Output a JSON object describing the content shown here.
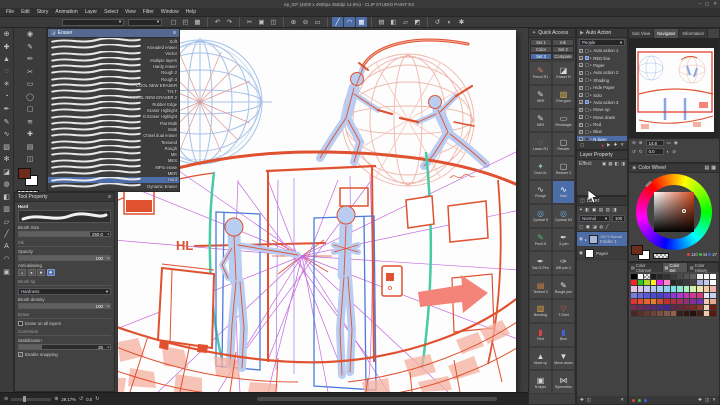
{
  "window": {
    "title": "ep_03* (4000 x 4500px 350dpi 14.8%) - CLIP STUDIO PAINT EX",
    "minimize": "–",
    "maximize": "▢",
    "close": "✕"
  },
  "menu": [
    "File",
    "Edit",
    "Story",
    "Animation",
    "Layer",
    "Select",
    "View",
    "Filter",
    "Window",
    "Help"
  ],
  "command_bar": {
    "icons": [
      {
        "name": "new-file",
        "glyph": "▢"
      },
      {
        "name": "open-file",
        "glyph": "◰"
      },
      {
        "name": "save-file",
        "glyph": "▦"
      },
      {
        "name": "sep"
      },
      {
        "name": "undo",
        "glyph": "↶"
      },
      {
        "name": "redo",
        "glyph": "↷"
      },
      {
        "name": "sep"
      },
      {
        "name": "cut",
        "glyph": "✂"
      },
      {
        "name": "copy",
        "glyph": "▣"
      },
      {
        "name": "paste",
        "glyph": "◫"
      },
      {
        "name": "sep"
      },
      {
        "name": "zoom-in",
        "glyph": "⊕"
      },
      {
        "name": "zoom-out",
        "glyph": "⊖"
      },
      {
        "name": "fit-screen",
        "glyph": "▭"
      },
      {
        "name": "sep"
      },
      {
        "name": "snap-ruler",
        "glyph": "╱",
        "active": true
      },
      {
        "name": "snap-special-ruler",
        "glyph": "◠",
        "active": true
      },
      {
        "name": "snap-grid",
        "glyph": "▦",
        "active": true
      },
      {
        "name": "sep"
      },
      {
        "name": "grid",
        "glyph": "▤"
      },
      {
        "name": "material",
        "glyph": "◧"
      },
      {
        "name": "select-area",
        "glyph": "▱"
      },
      {
        "name": "deselect",
        "glyph": "◩"
      },
      {
        "name": "sep"
      },
      {
        "name": "rotate-view",
        "glyph": "↺"
      },
      {
        "name": "flip-view",
        "glyph": "◐"
      },
      {
        "name": "settings",
        "glyph": "✱"
      }
    ]
  },
  "tool_strip_a": [
    {
      "name": "zoom-tool",
      "glyph": "⊕"
    },
    {
      "name": "move-tool",
      "glyph": "✚"
    },
    {
      "name": "operation-tool",
      "glyph": "▲"
    },
    {
      "name": "selection-tool",
      "glyph": "◌"
    },
    {
      "name": "wand-tool",
      "glyph": "✳"
    },
    {
      "name": "eyedropper-tool",
      "glyph": "◔"
    },
    {
      "name": "pen-tool",
      "glyph": "✒"
    },
    {
      "name": "pencil-tool",
      "glyph": "✎"
    },
    {
      "name": "brush-tool",
      "glyph": "∿"
    },
    {
      "name": "airbrush-tool",
      "glyph": "▨"
    },
    {
      "name": "decoration-tool",
      "glyph": "✻"
    },
    {
      "name": "eraser-tool",
      "glyph": "◪"
    },
    {
      "name": "blend-tool",
      "glyph": "◍"
    },
    {
      "name": "fill-tool",
      "glyph": "◧"
    },
    {
      "name": "gradient-tool",
      "glyph": "▥"
    },
    {
      "name": "figure-tool",
      "glyph": "▱"
    },
    {
      "name": "ruler-tool",
      "glyph": "╱"
    },
    {
      "name": "text-tool",
      "glyph": "A"
    },
    {
      "name": "balloon-tool",
      "glyph": "◠"
    },
    {
      "name": "frame-border-tool",
      "glyph": "▣"
    }
  ],
  "tool_strip_b": [
    {
      "name": "subtool-marker",
      "glyph": "◉"
    },
    {
      "name": "subtool-pen",
      "glyph": "✎"
    },
    {
      "name": "subtool-pencil",
      "glyph": "✏"
    },
    {
      "name": "subtool-scissors",
      "glyph": "✂"
    },
    {
      "name": "subtool-rect",
      "glyph": "▭"
    },
    {
      "name": "subtool-circle",
      "glyph": "◯"
    },
    {
      "name": "subtool-square",
      "glyph": "▢"
    },
    {
      "name": "subtool-wave",
      "glyph": "≋"
    },
    {
      "name": "subtool-plus",
      "glyph": "✚"
    },
    {
      "name": "subtool-rows",
      "glyph": "▤"
    },
    {
      "name": "subtool-panel",
      "glyph": "◫"
    }
  ],
  "tool_strip_b_tail": [
    {
      "name": "subtool-grid2",
      "glyph": "▦"
    },
    {
      "name": "subtool-diamond",
      "glyph": "◈"
    }
  ],
  "colors": {
    "foreground": "#6e2c1b",
    "background": "#ffffff",
    "selection": "#4d6da8",
    "accent_green": "#3aa34a"
  },
  "subtool": {
    "header": "Eraser",
    "selected": "Hard",
    "items": [
      "Soft",
      "Kneaded eraser",
      "Vector",
      "Multiple layers",
      "Hardy eraser",
      "Rough 2",
      "Rough 3",
      "COOL NEW ERASER",
      "T.N.T",
      "COOL NEW ERASER 2",
      "Rubber Edge",
      "Eraser Highlight",
      "G.Eraser Highlight",
      "Flat Multi",
      "Multi",
      "Chisel dual eraser",
      "Textured",
      "Rough",
      "ME",
      "MES",
      "MPro erase",
      "MER",
      "Hard",
      "Dynamic Eraser"
    ]
  },
  "tool_property": {
    "header": "Tool Property",
    "tool": "Hard",
    "brush_size_label": "Brush Size",
    "brush_size": "250.0",
    "ink_section": "Ink",
    "opacity_label": "Opacity",
    "opacity": "100",
    "anti_aliasing_label": "Anti-aliasing",
    "brush_tip_section": "Brush tip",
    "tip_shape": "Hardness",
    "density_label": "Brush density",
    "density": "100",
    "erase_section": "Erase",
    "erase_all_label": "Erase on all layers",
    "correction_section": "Correction",
    "stabilization_label": "Stabilization",
    "stabilization": "25",
    "snapping_label": "Enable snapping"
  },
  "quick_access": {
    "header": "Quick Access",
    "sets": [
      "Set 1",
      "Ink",
      "Color",
      "Set 2",
      "Set 3",
      "Compare"
    ],
    "active_set": "Set 3",
    "selected_tool": "Hard",
    "tools": [
      {
        "label": "Pencil R1",
        "glyph": "✎",
        "color": "#e07a5a"
      },
      {
        "label": "Eraser H",
        "glyph": "◪",
        "color": "#d8d8d8"
      },
      {
        "label": "MER",
        "glyph": "✎",
        "color": "#d8d8d8"
      },
      {
        "label": "Rim gum",
        "glyph": "▨",
        "color": "#d8b84a"
      },
      {
        "label": "MES",
        "glyph": "✎",
        "color": "#d8d8d8"
      },
      {
        "label": "Rectangle",
        "glyph": "▭",
        "color": "#d8d8d8"
      },
      {
        "label": "Lasso R1",
        "glyph": "◌",
        "color": "#7ec8b0"
      },
      {
        "label": "Resizer",
        "glyph": "▢",
        "color": "#d8d8d8"
      },
      {
        "label": "Dust Gr",
        "glyph": "✦",
        "color": "#7ec8b0"
      },
      {
        "label": "Resizer 2",
        "glyph": "▢",
        "color": "#d8d8d8"
      },
      {
        "label": "Rough",
        "glyph": "∿",
        "color": "#d8d8d8"
      },
      {
        "label": "Hard",
        "glyph": "∿",
        "color": "#ffffff"
      },
      {
        "label": "Cymbal H",
        "glyph": "◎",
        "color": "#6fa8dc"
      },
      {
        "label": "Cymbal H2",
        "glyph": "◎",
        "color": "#6fa8dc"
      },
      {
        "label": "Pecil H",
        "glyph": "✎",
        "color": "#5bb87a"
      },
      {
        "label": "G-pen",
        "glyph": "✒",
        "color": "#d8d8d8"
      },
      {
        "label": "Sat G-Pen",
        "glyph": "✒",
        "color": "#d8d8d8"
      },
      {
        "label": "WB pen 2",
        "glyph": "✑",
        "color": "#d8d8d8"
      },
      {
        "label": "Textred 2",
        "glyph": "▤",
        "color": "#d8864a"
      },
      {
        "label": "Rough pen",
        "glyph": "✎",
        "color": "#e0e0e0"
      },
      {
        "label": "Bending",
        "glyph": "▧",
        "color": "#e0a040"
      },
      {
        "label": "T-Shirt",
        "glyph": "▽",
        "color": "#d05050"
      },
      {
        "label": "Red",
        "glyph": "▮",
        "color": "#e04040"
      },
      {
        "label": "Blue",
        "glyph": "▮",
        "color": "#4060e0"
      },
      {
        "label": "Move up",
        "glyph": "▲",
        "color": "#d8d8d8"
      },
      {
        "label": "Move down",
        "glyph": "▼",
        "color": "#d8d8d8"
      },
      {
        "label": "N layer",
        "glyph": "▣",
        "color": "#d8d8d8"
      },
      {
        "label": "Symmetric",
        "glyph": "⋈",
        "color": "#d8d8d8"
      }
    ]
  },
  "auto_action": {
    "header": "Auto Action",
    "group": "People",
    "selected": "N layer",
    "actions": [
      {
        "label": "Auto action 1",
        "chip": false
      },
      {
        "label": "RED line",
        "chip": true
      },
      {
        "label": "Paper",
        "chip": false
      },
      {
        "label": "Auto action 2",
        "chip": false
      },
      {
        "label": "Shading",
        "chip": false
      },
      {
        "label": "Hide Paper",
        "chip": false
      },
      {
        "label": "Solo",
        "chip": false
      },
      {
        "label": "Auto action 3",
        "chip": true
      },
      {
        "label": "Move up",
        "chip": false
      },
      {
        "label": "Move down",
        "chip": false
      },
      {
        "label": "Red",
        "chip": false
      },
      {
        "label": "Blue",
        "chip": false
      },
      {
        "label": "N layer",
        "chip": false
      }
    ]
  },
  "layer_property": {
    "header": "Layer Property",
    "effect_label": "Effect"
  },
  "layer": {
    "header": "Layer",
    "blend_mode": "Normal",
    "opacity": "100",
    "items": [
      {
        "name": "Folder 1",
        "info": "100 % Normal",
        "kind": "folder",
        "selected": true
      },
      {
        "name": "Paper",
        "info": "",
        "kind": "paper",
        "selected": false
      }
    ]
  },
  "navigator": {
    "tabs": [
      "Sub View",
      "Navigator",
      "Information"
    ],
    "active_tab": "Navigator",
    "zoom": "14.8",
    "rotation": "0.0"
  },
  "color_wheel": {
    "header": "Color Wheel",
    "r_value": "110",
    "g_value": "44",
    "b_value": "27"
  },
  "color_set": {
    "tabs": [
      "Color Channel",
      "Color Set",
      "Color History"
    ],
    "active_tab": "Color Set",
    "swatches": [
      [
        "#000000",
        "#ffffff",
        "checker",
        "#1c1c1c",
        "#282828",
        "#333333",
        "#3e3e3e",
        "#4a4a4a",
        "#555555",
        "#606060",
        "#f0f0f0",
        "#f8f8f8",
        "#ffffff"
      ],
      [
        "#ff2020",
        "#22cc22",
        "#aadd22",
        "#ffee22",
        "#ee22ee",
        "#ff88cc",
        "#262626",
        "#303030",
        "#3a3a3a",
        "#444444",
        "#aab0e0",
        "#c6ccf0",
        "#ffffff"
      ],
      [
        "#e6c6e6",
        "#d9c6f0",
        "#c6c6f5",
        "#b3c6f5",
        "#a0ccf5",
        "#8cd2f0",
        "#7edce6",
        "#8ce6d2",
        "#aaf0c6",
        "#d2f0aa",
        "#f0e6aa",
        "#f0cfa8",
        "#f0b4a8"
      ],
      [
        "#7a7ae6",
        "#6a6ae0",
        "#5a5ad9",
        "#4a4ad2",
        "#4444cc",
        "#6a3ad2",
        "#8a3ad2",
        "#aa3ad2",
        "#c23ab8",
        "#cc3a9a",
        "#d23a7a",
        "#e6e6f7",
        "#c8cdf2"
      ],
      [
        "#e63030",
        "#e64a30",
        "#e66430",
        "#e67e30",
        "#d24a30",
        "#c23030",
        "#b2303e",
        "#a2305c",
        "#92307a",
        "#823098",
        "#7230b6",
        "#f2c6b2",
        "#e6a88e"
      ],
      [
        "#7a2a52",
        "#6e2a5e",
        "#622a6a",
        "#562a76",
        "#4a2a82",
        "#3e2a8e",
        "#5a2a4a",
        "#662a3e",
        "#722a32",
        "#7e2a2a",
        "#8a3a2a",
        "#f0d2ba",
        "#6a1e14"
      ],
      [
        "#4a2622",
        "#56302a",
        "#623a32",
        "#6e443a",
        "#7a4e42",
        "#865848",
        "#926250",
        "#3a1e1a",
        "#2e1812",
        "#24120e",
        "#451f16",
        "#eccab0",
        "#58180e"
      ]
    ]
  },
  "status_bar": {
    "zoom": "29.17%",
    "rotation": "0.0"
  },
  "canvas": {
    "hl_label": "HL"
  }
}
